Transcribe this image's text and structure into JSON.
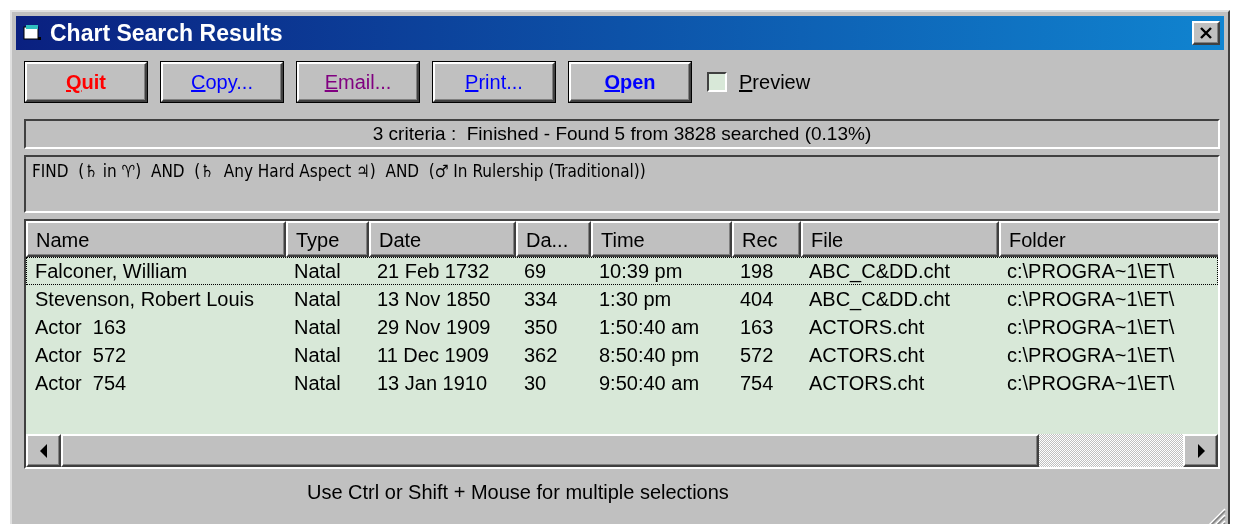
{
  "window": {
    "title": "Chart Search Results"
  },
  "buttons": [
    {
      "label": "Quit",
      "color": "#ff0000",
      "bold": true
    },
    {
      "label": "Copy...",
      "color": "#0000ff",
      "bold": false
    },
    {
      "label": "Email...",
      "color": "#800080",
      "bold": false
    },
    {
      "label": "Print...",
      "color": "#0000ff",
      "bold": false
    },
    {
      "label": "Open",
      "color": "#0000ff",
      "bold": true
    }
  ],
  "preview": {
    "label": "Preview",
    "checked": false
  },
  "status": "3 criteria :  Finished - Found 5 from 3828 searched (0.13%)",
  "criteria": "FIND  (♄ in ♈)  AND  (♄  Any Hard Aspect ♃)  AND  (♂ In Rulership (Traditional))",
  "table": {
    "columns": [
      "Name",
      "Type",
      "Date",
      "Da...",
      "Time",
      "Rec",
      "File",
      "Folder"
    ],
    "rows": [
      {
        "focused": true,
        "cells": [
          "Falconer, William",
          "Natal",
          "21 Feb 1732",
          "69",
          "10:39 pm",
          "198",
          "ABC_C&DD.cht",
          "c:\\PROGRA~1\\ET\\"
        ]
      },
      {
        "focused": false,
        "cells": [
          "Stevenson, Robert Louis",
          "Natal",
          "13 Nov 1850",
          "334",
          "1:30 pm",
          "404",
          "ABC_C&DD.cht",
          "c:\\PROGRA~1\\ET\\"
        ]
      },
      {
        "focused": false,
        "cells": [
          "Actor  163",
          "Natal",
          "29 Nov 1909",
          "350",
          "1:50:40 am",
          "163",
          "ACTORS.cht",
          "c:\\PROGRA~1\\ET\\"
        ]
      },
      {
        "focused": false,
        "cells": [
          "Actor  572",
          "Natal",
          "11 Dec 1909",
          "362",
          "8:50:40 pm",
          "572",
          "ACTORS.cht",
          "c:\\PROGRA~1\\ET\\"
        ]
      },
      {
        "focused": false,
        "cells": [
          "Actor  754",
          "Natal",
          "13 Jan 1910",
          "30",
          "9:50:40 am",
          "754",
          "ACTORS.cht",
          "c:\\PROGRA~1\\ET\\"
        ]
      }
    ]
  },
  "hint": "Use Ctrl or Shift + Mouse for multiple selections"
}
